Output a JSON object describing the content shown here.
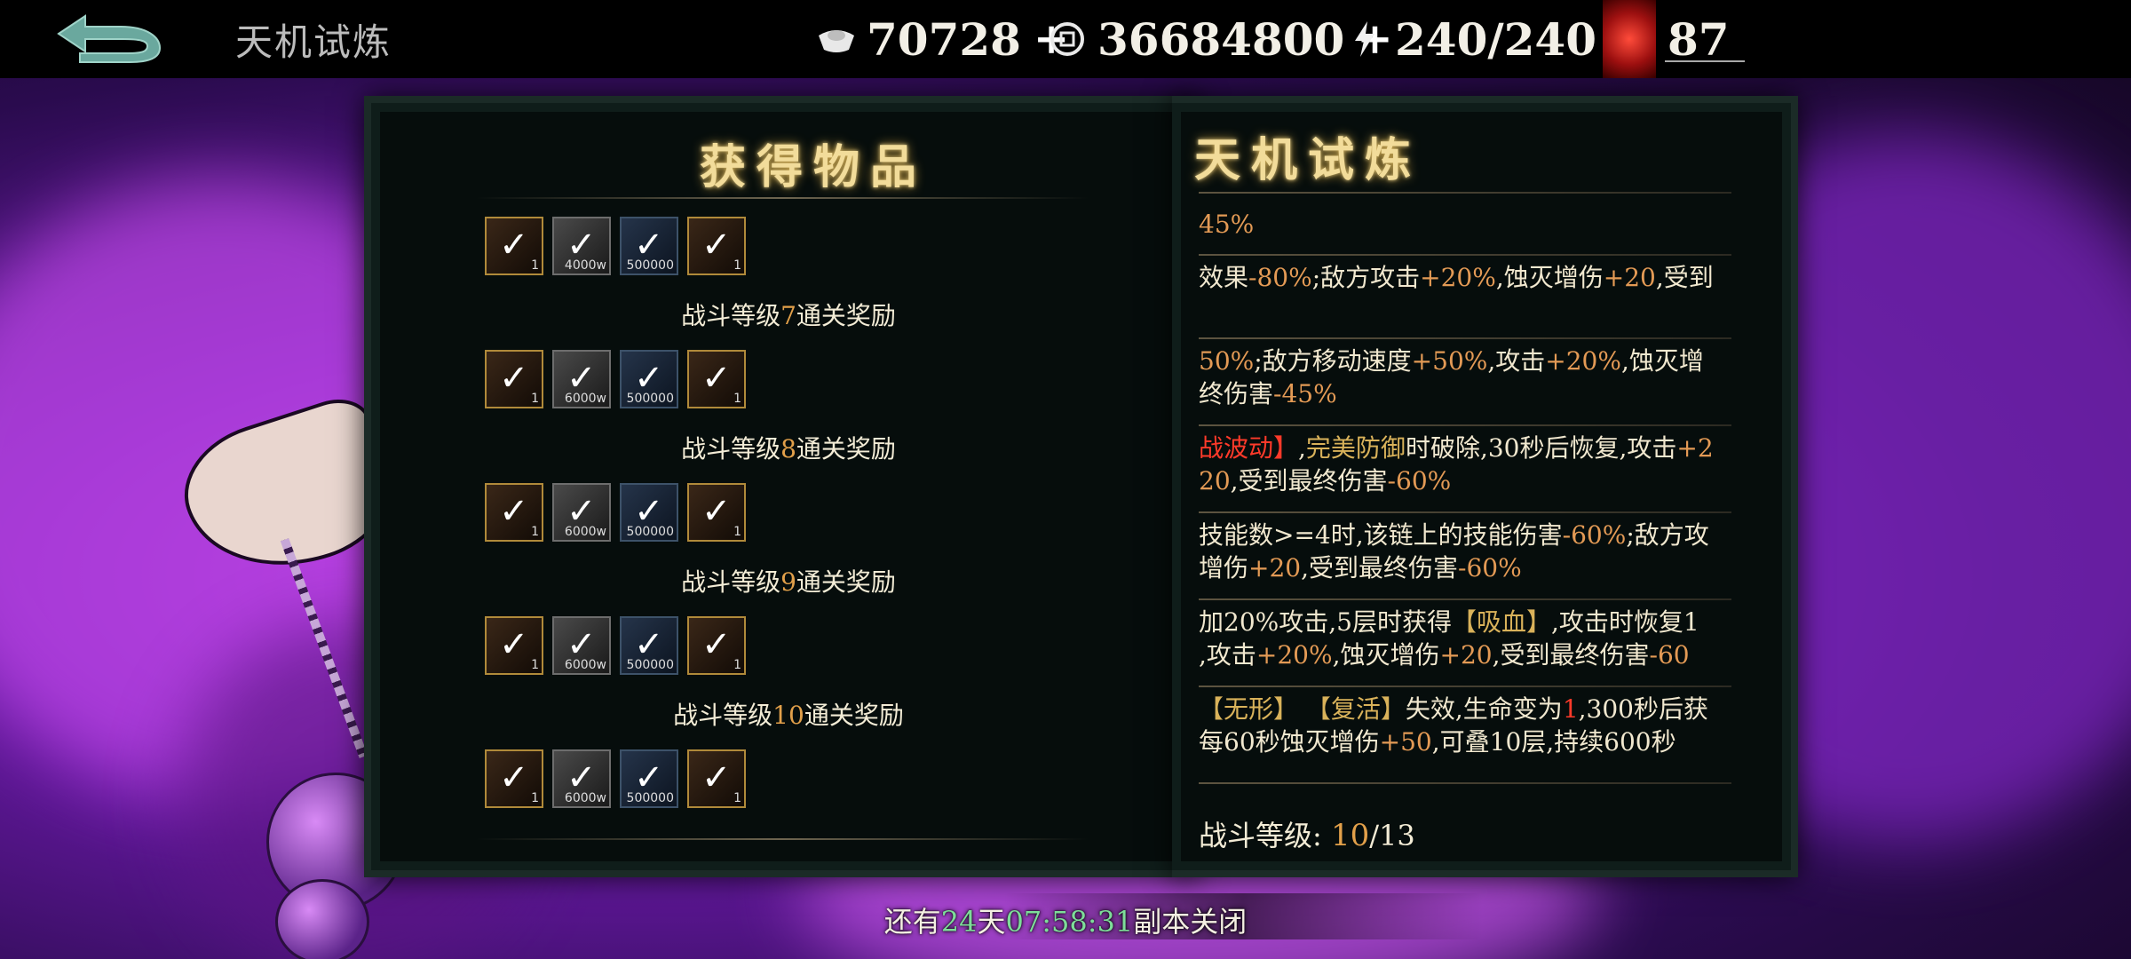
{
  "header": {
    "title": "天机试炼",
    "currencies": [
      {
        "icon": "silver-ingot-icon",
        "value": "70728"
      },
      {
        "icon": "coin-icon",
        "value": "36684800"
      },
      {
        "icon": "lightning-icon",
        "value": "240/240"
      },
      {
        "icon": "demon-mask-icon",
        "value": "87"
      }
    ],
    "plus": "+"
  },
  "rewards_panel": {
    "title": "获得物品",
    "rows": [
      {
        "items": [
          {
            "qty": "1"
          },
          {
            "qty": "4000w"
          },
          {
            "qty": "500000"
          },
          {
            "qty": "1"
          }
        ],
        "label_pre": "战斗等级",
        "level": "7",
        "label_post": "通关奖励"
      },
      {
        "items": [
          {
            "qty": "1"
          },
          {
            "qty": "6000w"
          },
          {
            "qty": "500000"
          },
          {
            "qty": "1"
          }
        ],
        "label_pre": "战斗等级",
        "level": "8",
        "label_post": "通关奖励"
      },
      {
        "items": [
          {
            "qty": "1"
          },
          {
            "qty": "6000w"
          },
          {
            "qty": "500000"
          },
          {
            "qty": "1"
          }
        ],
        "label_pre": "战斗等级",
        "level": "9",
        "label_post": "通关奖励"
      },
      {
        "items": [
          {
            "qty": "1"
          },
          {
            "qty": "6000w"
          },
          {
            "qty": "500000"
          },
          {
            "qty": "1"
          }
        ],
        "label_pre": "战斗等级",
        "level": "10",
        "label_post": "通关奖励"
      },
      {
        "items": [
          {
            "qty": "1"
          },
          {
            "qty": "6000w"
          },
          {
            "qty": "500000"
          },
          {
            "qty": "1"
          }
        ]
      }
    ]
  },
  "trial_panel": {
    "title": "天机试炼",
    "effects": [
      {
        "lines": [
          [
            {
              "t": "45%",
              "c": "neg"
            }
          ]
        ]
      },
      {
        "lines": [
          [
            {
              "t": "效果"
            },
            {
              "t": "-80%",
              "c": "neg"
            },
            {
              "t": ";敌方攻击"
            },
            {
              "t": "+20%",
              "c": "neg"
            },
            {
              "t": ",蚀灭增伤"
            },
            {
              "t": "+20",
              "c": "neg"
            },
            {
              "t": ",受到"
            }
          ]
        ]
      },
      {
        "lines": [
          [
            {
              "t": "50%",
              "c": "neg"
            },
            {
              "t": ";敌方移动速度"
            },
            {
              "t": "+50%",
              "c": "neg"
            },
            {
              "t": ",攻击"
            },
            {
              "t": "+20%",
              "c": "neg"
            },
            {
              "t": ",蚀灭增"
            }
          ],
          [
            {
              "t": "终伤害"
            },
            {
              "t": "-45%",
              "c": "neg"
            }
          ]
        ]
      },
      {
        "lines": [
          [
            {
              "t": "战波动】",
              "c": "red"
            },
            {
              "t": ","
            },
            {
              "t": "完美防御",
              "c": "rel"
            },
            {
              "t": "时破除,30秒后恢复,攻击"
            },
            {
              "t": "+2",
              "c": "neg"
            }
          ],
          [
            {
              "t": "20",
              "c": "neg"
            },
            {
              "t": ",受到最终伤害"
            },
            {
              "t": "-60%",
              "c": "neg"
            }
          ]
        ]
      },
      {
        "lines": [
          [
            {
              "t": "技能数>=4时,该链上的技能伤害"
            },
            {
              "t": "-60%",
              "c": "neg"
            },
            {
              "t": ";敌方攻"
            }
          ],
          [
            {
              "t": "增伤"
            },
            {
              "t": "+20",
              "c": "neg"
            },
            {
              "t": ",受到最终伤害"
            },
            {
              "t": "-60%",
              "c": "neg"
            }
          ]
        ]
      },
      {
        "lines": [
          [
            {
              "t": "加20%攻击,5层时获得"
            },
            {
              "t": "【吸血】",
              "c": "rel"
            },
            {
              "t": ",攻击时恢复1"
            }
          ],
          [
            {
              "t": ",攻击"
            },
            {
              "t": "+20%",
              "c": "neg"
            },
            {
              "t": ",蚀灭增伤"
            },
            {
              "t": "+20",
              "c": "neg"
            },
            {
              "t": ",受到最终伤害"
            },
            {
              "t": "-60",
              "c": "neg"
            }
          ]
        ]
      },
      {
        "lines": [
          [
            {
              "t": "【无形】 【复活】",
              "c": "rel"
            },
            {
              "t": "失效,生命变为"
            },
            {
              "t": "1",
              "c": "red"
            },
            {
              "t": ",300秒后获"
            }
          ],
          [
            {
              "t": "每60秒蚀灭增伤"
            },
            {
              "t": "+50",
              "c": "neg"
            },
            {
              "t": ",可叠10层,持续600秒"
            }
          ]
        ]
      }
    ],
    "level_label": "战斗等级:",
    "level_current": "10",
    "level_sep": "/",
    "level_max": "13"
  },
  "countdown": {
    "pre": "还有",
    "days": "24",
    "days_unit": "天",
    "time": "07:58:31",
    "post": "副本关闭"
  },
  "colors": {
    "highlight": "#e2a04a",
    "red": "#ff3a2a",
    "green": "#7edd9a",
    "gold_title": "#f2dc9a"
  }
}
